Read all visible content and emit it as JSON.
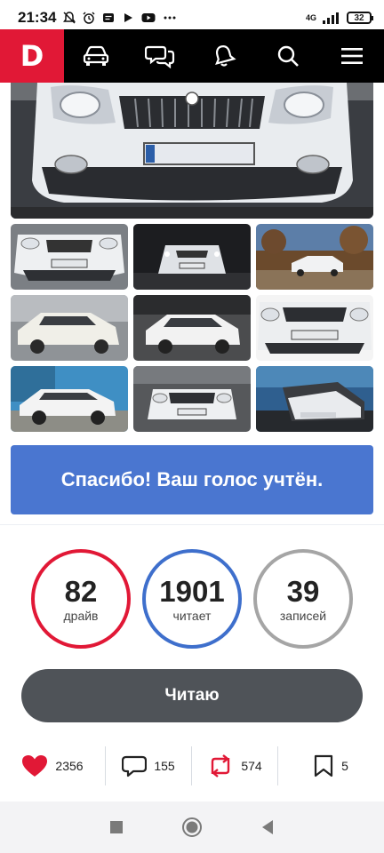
{
  "status_bar": {
    "time": "21:34",
    "network": "4G",
    "battery": "32",
    "icons": [
      "mute-icon",
      "alarm-icon",
      "message-icon",
      "play-icon",
      "youtube-icon",
      "more-icon"
    ]
  },
  "app_bar": {
    "logo": "D",
    "nav": [
      "car-icon",
      "chat-icon",
      "bell-icon",
      "search-icon",
      "menu-icon"
    ],
    "logo_color": "#e11836"
  },
  "vote": {
    "message": "Спасибо! Ваш голос учтён.",
    "color": "#4a76d0"
  },
  "stats": [
    {
      "value": "82",
      "label": "драйв",
      "color": "#e11836"
    },
    {
      "value": "1901",
      "label": "читает",
      "color": "#3e6fcc"
    },
    {
      "value": "39",
      "label": "записей",
      "color": "#a5a5a5"
    }
  ],
  "read_button": {
    "label": "Читаю"
  },
  "actions": [
    {
      "icon": "heart-icon",
      "count": "2356"
    },
    {
      "icon": "comment-icon",
      "count": "155"
    },
    {
      "icon": "repost-icon",
      "count": "574"
    },
    {
      "icon": "bookmark-icon",
      "count": "5"
    }
  ],
  "nav_bar": [
    "recents-square-icon",
    "home-circle-icon",
    "back-triangle-icon"
  ]
}
